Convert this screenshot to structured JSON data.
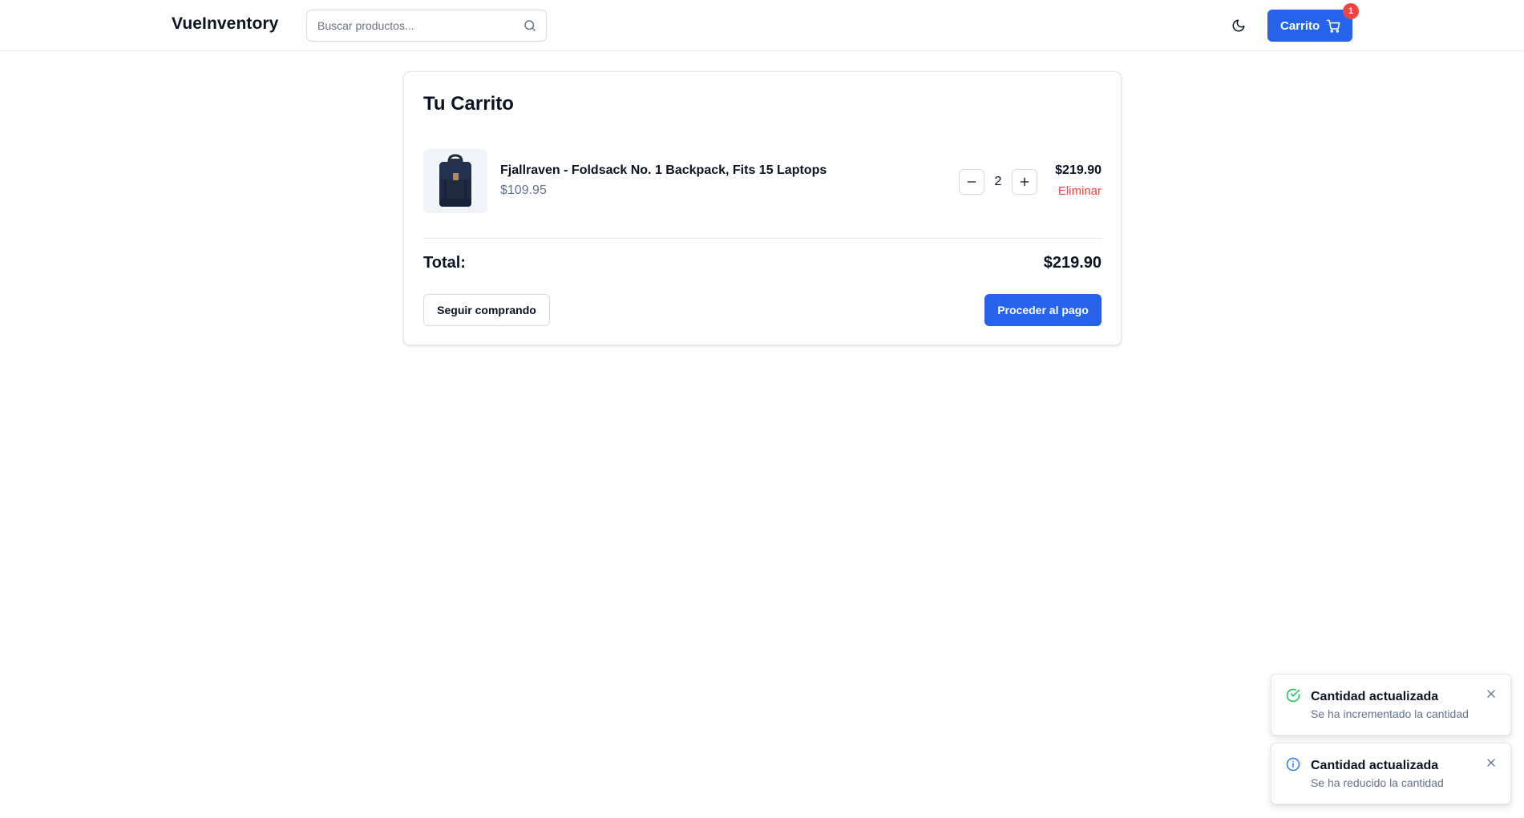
{
  "header": {
    "logo": "VueInventory",
    "search_placeholder": "Buscar productos...",
    "cart_label": "Carrito",
    "cart_badge": "1"
  },
  "cart": {
    "title": "Tu Carrito",
    "items": [
      {
        "name": "Fjallraven - Foldsack No. 1 Backpack, Fits 15 Laptops",
        "unit_price": "$109.95",
        "quantity": "2",
        "line_total": "$219.90",
        "remove_label": "Eliminar"
      }
    ],
    "total_label": "Total:",
    "total_value": "$219.90",
    "continue_label": "Seguir comprando",
    "checkout_label": "Proceder al pago"
  },
  "toasts": [
    {
      "type": "success",
      "icon": "check-circle-icon",
      "title": "Cantidad actualizada",
      "message": "Se ha incrementado la cantidad"
    },
    {
      "type": "info",
      "icon": "info-circle-icon",
      "title": "Cantidad actualizada",
      "message": "Se ha reducido la cantidad"
    }
  ],
  "colors": {
    "primary": "#2563eb",
    "danger": "#ef4444",
    "success": "#22c55e",
    "info": "#3b82f6",
    "muted": "#64748b"
  }
}
